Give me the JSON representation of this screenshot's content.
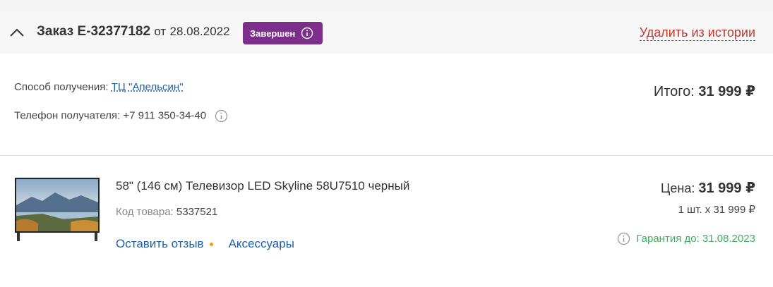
{
  "order": {
    "label": "Заказ",
    "number": "E-32377182",
    "date_prefix": "от",
    "date": "28.08.2022",
    "status": "Завершен",
    "delete_label": "Удалить из истории"
  },
  "delivery": {
    "method_label": "Способ получения:",
    "method_value": "ТЦ \"Апельсин\"",
    "phone_label": "Телефон получателя:",
    "phone_value": "+7 911 350-34-40"
  },
  "total": {
    "label": "Итого:",
    "value": "31 999 ₽"
  },
  "product": {
    "name": "58\" (146 см) Телевизор LED Skyline 58U7510 черный",
    "code_label": "Код товара:",
    "code_value": "5337521",
    "review_label": "Оставить отзыв",
    "accessories_label": "Аксессуары",
    "price_label": "Цена:",
    "price_value": "31 999 ₽",
    "qty_text": "1 шт. x 31 999 ₽",
    "warranty_text": "Гарантия до: 31.08.2023"
  },
  "colors": {
    "status_badge": "#7b2f8a",
    "delete_link": "#c0392b",
    "link": "#1f5fa8",
    "warranty": "#3fae5a",
    "review_dot": "#f39c12"
  }
}
